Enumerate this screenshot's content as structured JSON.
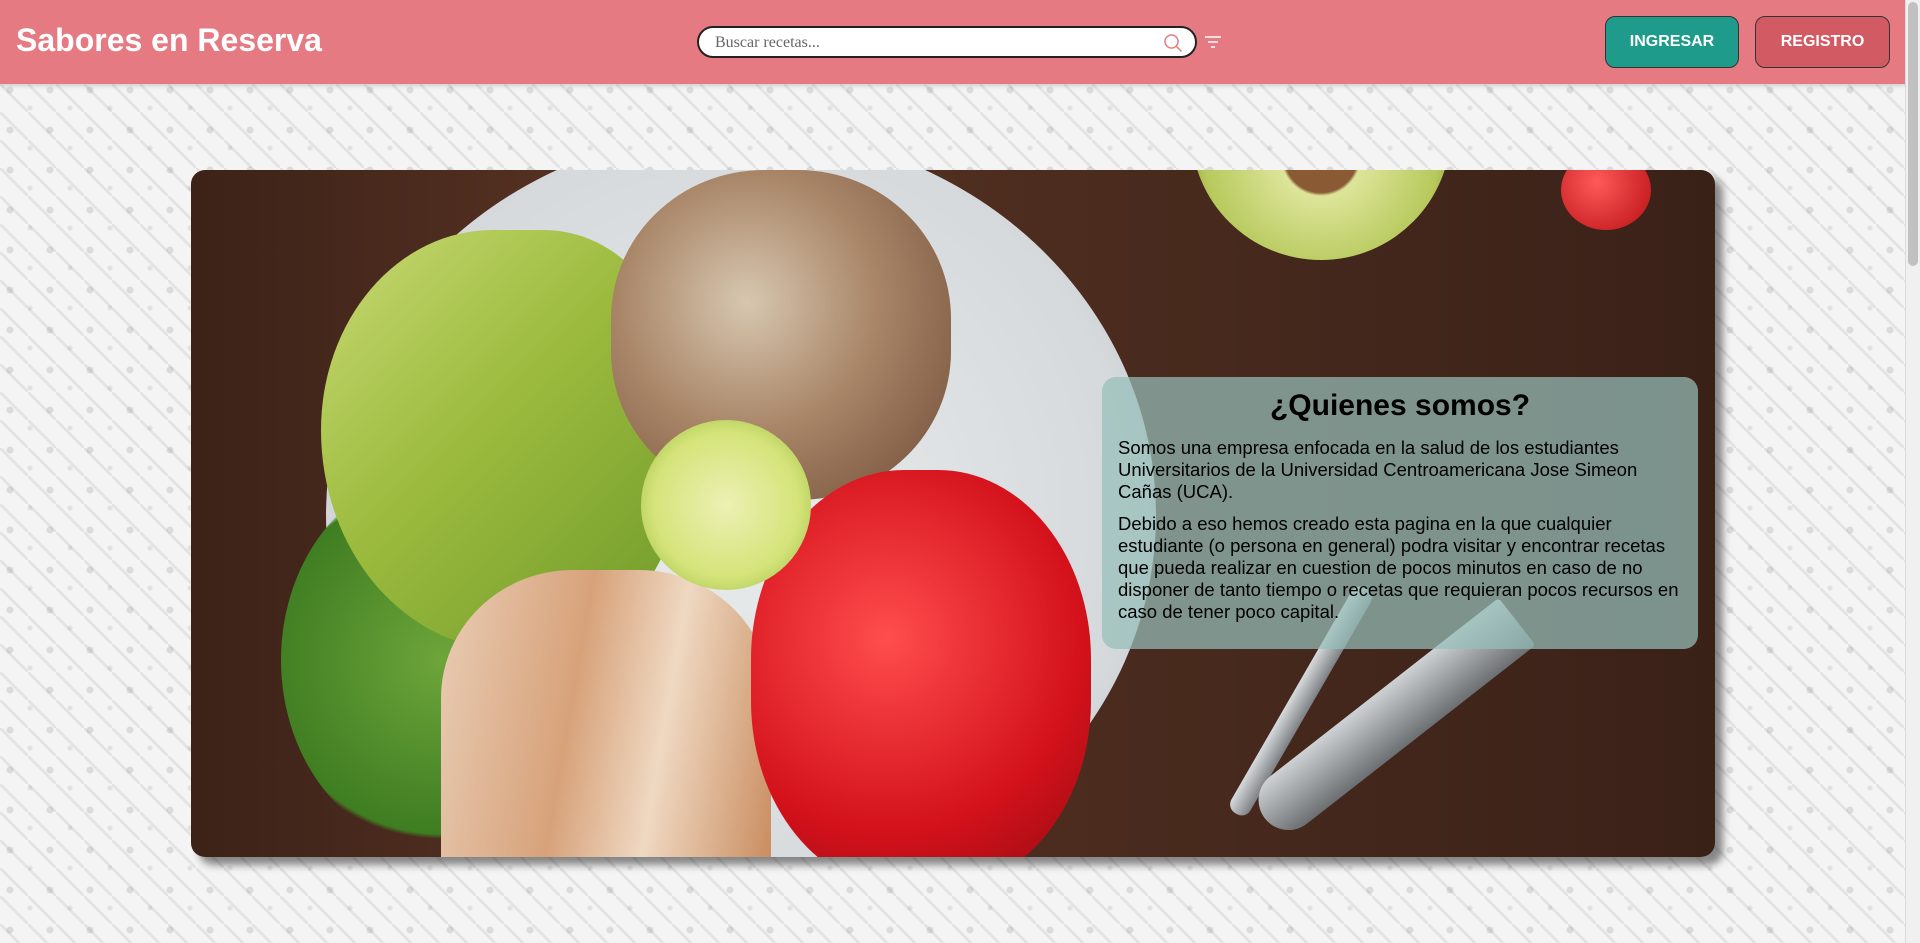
{
  "header": {
    "brand": "Sabores en Reserva",
    "search": {
      "placeholder": "Buscar recetas...",
      "value": ""
    },
    "login_label": "INGRESAR",
    "register_label": "REGISTRO"
  },
  "hero": {
    "card": {
      "title": "¿Quienes somos?",
      "paragraphs": [
        "Somos una empresa enfocada en la salud de los estudiantes Universitarios de la Universidad Centroamericana Jose Simeon Cañas (UCA).",
        "Debido a eso hemos creado esta pagina en la que cualquier estudiante (o persona en general) podra visitar y encontrar recetas que pueda realizar en cuestion de pocos minutos en caso de no disponer de tanto tiempo o recetas que requieran pocos recursos en caso de tener poco capital."
      ]
    }
  },
  "colors": {
    "header_bg": "#e67a82",
    "login_bg": "#1f9b8c",
    "register_bg": "#d25a63"
  },
  "icons": {
    "search": "search-icon",
    "filter": "filter-icon"
  }
}
